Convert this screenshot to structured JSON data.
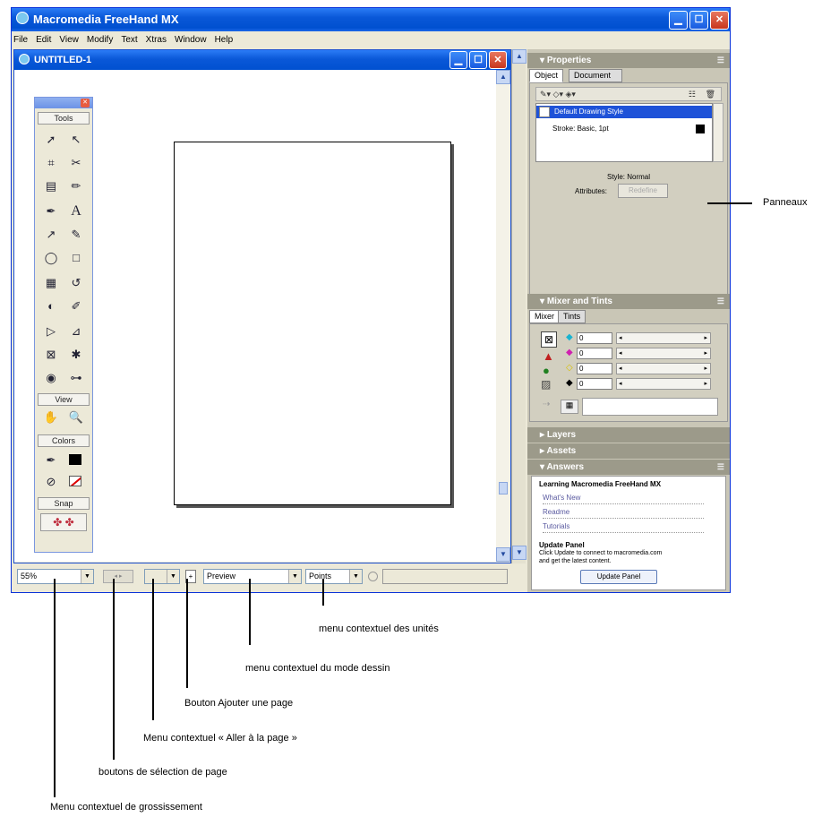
{
  "app": {
    "title": "Macromedia FreeHand MX"
  },
  "menu": [
    "File",
    "Edit",
    "View",
    "Modify",
    "Text",
    "Xtras",
    "Window",
    "Help"
  ],
  "document": {
    "title": "UNTITLED-1"
  },
  "tools": {
    "sections": {
      "tools": "Tools",
      "view": "View",
      "colors": "Colors",
      "snap": "Snap"
    },
    "glyphs": [
      "➚",
      "↖",
      "⌗",
      "✂",
      "▤",
      "✏",
      "✒",
      "A",
      "↗",
      "✎",
      "◯",
      "□",
      "▦",
      "↺",
      "◐",
      "✐",
      "▷",
      "⊿",
      "⊠",
      "✱",
      "◉",
      "⊶"
    ]
  },
  "status_bar": {
    "zoom": "55%",
    "draw_mode": "Preview",
    "units": "Points"
  },
  "panels": {
    "properties": {
      "title": "Properties",
      "tabs": [
        "Object",
        "Document"
      ],
      "items": [
        "Default Drawing Style",
        "Stroke: Basic, 1pt"
      ],
      "style_label": "Style: Normal",
      "attributes_label": "Attributes:",
      "redefine_label": "Redefine"
    },
    "mixer": {
      "title": "Mixer and Tints",
      "tabs": [
        "Mixer",
        "Tints"
      ],
      "values": [
        "0",
        "0",
        "0",
        "0"
      ]
    },
    "layers": {
      "title": "Layers"
    },
    "assets": {
      "title": "Assets"
    },
    "answers": {
      "title": "Answers",
      "heading": "Learning Macromedia FreeHand MX",
      "links": [
        "What's New",
        "Readme",
        "Tutorials"
      ],
      "update_heading": "Update Panel",
      "update_text_1": "Click Update to connect to macromedia.com",
      "update_text_2": "and get the latest content.",
      "update_button": "Update Panel"
    }
  },
  "callouts": {
    "panneaux": "Panneaux",
    "units": "menu contextuel des unités",
    "draw_mode": "menu contextuel du mode dessin",
    "add_page": "Bouton Ajouter une page",
    "goto_page": "Menu contextuel « Aller à la page »",
    "page_select": "boutons de sélection de page",
    "zoom": "Menu contextuel de grossissement"
  },
  "colors": {
    "titlebar": "#0a58d8",
    "panel_header": "#9c9a8a",
    "panel_bg": "#c9c6b6",
    "window_bg": "#ece9d8"
  }
}
